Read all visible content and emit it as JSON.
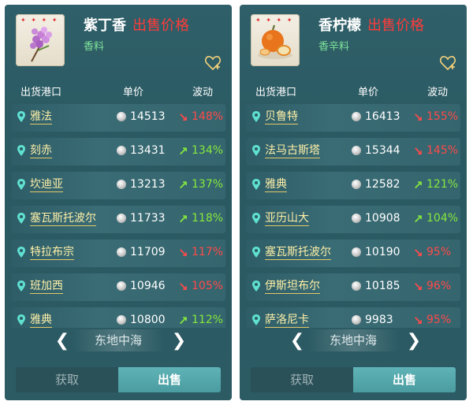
{
  "panels": [
    {
      "item_name": "紫丁香",
      "sell_price_label": "出售价格",
      "item_type": "香料",
      "stars": "✦ ✦ ✦ ✦",
      "headers": {
        "port": "出货港口",
        "price": "单价",
        "change": "波动"
      },
      "rows": [
        {
          "port": "雅法",
          "price": "14513",
          "direction": "down",
          "change": "148%"
        },
        {
          "port": "刻赤",
          "price": "13431",
          "direction": "up",
          "change": "134%"
        },
        {
          "port": "坎迪亚",
          "price": "13213",
          "direction": "up",
          "change": "137%"
        },
        {
          "port": "塞瓦斯托波尔",
          "price": "11733",
          "direction": "up",
          "change": "118%"
        },
        {
          "port": "特拉布宗",
          "price": "11709",
          "direction": "down",
          "change": "117%"
        },
        {
          "port": "班加西",
          "price": "10946",
          "direction": "down",
          "change": "105%"
        },
        {
          "port": "雅典",
          "price": "10800",
          "direction": "up",
          "change": "112%"
        }
      ],
      "region": "东地中海",
      "tabs": {
        "get": "获取",
        "sell": "出售"
      }
    },
    {
      "item_name": "香柠檬",
      "sell_price_label": "出售价格",
      "item_type": "香辛料",
      "stars": "✦ ✦ ✦ ✦",
      "headers": {
        "port": "出货港口",
        "price": "单价",
        "change": "波动"
      },
      "rows": [
        {
          "port": "贝鲁特",
          "price": "16413",
          "direction": "down",
          "change": "155%"
        },
        {
          "port": "法马古斯塔",
          "price": "15344",
          "direction": "down",
          "change": "145%"
        },
        {
          "port": "雅典",
          "price": "12582",
          "direction": "up",
          "change": "121%"
        },
        {
          "port": "亚历山大",
          "price": "10908",
          "direction": "up",
          "change": "104%"
        },
        {
          "port": "塞瓦斯托波尔",
          "price": "10190",
          "direction": "down",
          "change": "95%"
        },
        {
          "port": "伊斯坦布尔",
          "price": "10185",
          "direction": "down",
          "change": "96%"
        },
        {
          "port": "萨洛尼卡",
          "price": "9983",
          "direction": "down",
          "change": "95%"
        }
      ],
      "region": "东地中海",
      "tabs": {
        "get": "获取",
        "sell": "出售"
      }
    }
  ],
  "icons": {
    "heart": "heart-plus-icon",
    "pin": "location-pin-icon",
    "coin": "silver-coin-icon",
    "prev": "chevron-left-icon",
    "next": "chevron-right-icon"
  },
  "colors": {
    "panel_bg": "#2c5b64",
    "port_text": "#fff0a8",
    "up": "#86e83e",
    "down": "#ff4a4a",
    "sell_label": "#ff3b3b",
    "item_type": "#7fe39a",
    "active_tab": "#5fb3b6"
  }
}
